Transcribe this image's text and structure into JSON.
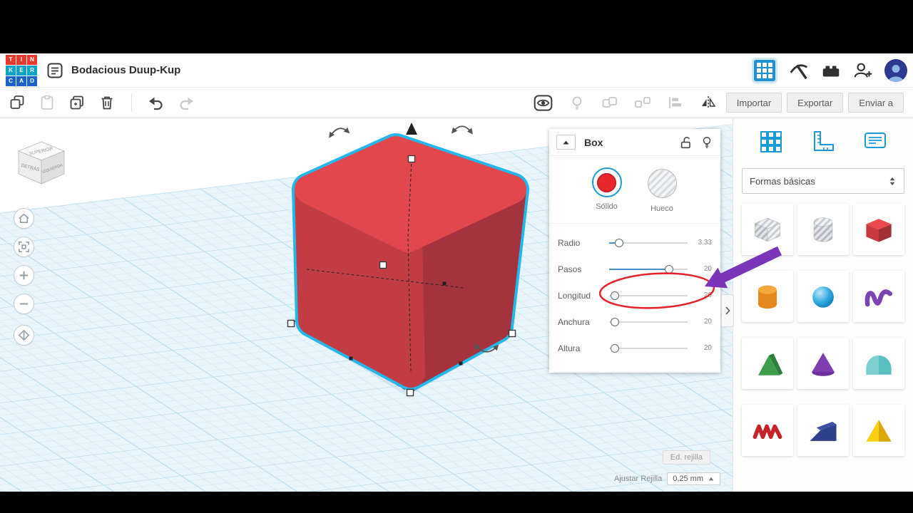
{
  "header": {
    "logo_rows": [
      [
        "T",
        "I",
        "N"
      ],
      [
        "K",
        "E",
        "R"
      ],
      [
        "C",
        "A",
        "D"
      ]
    ],
    "title": "Bodacious Duup-Kup"
  },
  "toolbar": {
    "import": "Importar",
    "export": "Exportar",
    "send": "Enviar a"
  },
  "viewport": {
    "viewcube": {
      "top": "SUPERIOR",
      "left": "DETRÁS",
      "right": "IZQUIERDA"
    },
    "grid_edit": "Ed. rejilla",
    "snap_label": "Ajustar Rejilla",
    "snap_value": "0,25 mm"
  },
  "inspector": {
    "title": "Box",
    "materials": [
      {
        "label": "Sólido",
        "selected": true
      },
      {
        "label": "Hueco",
        "selected": false
      }
    ],
    "sliders": [
      {
        "label": "Radio",
        "value": "3.33",
        "knob_pct": 13,
        "fill_pct": 9
      },
      {
        "label": "Pasos",
        "value": "20",
        "knob_pct": 76,
        "fill_pct": 76
      },
      {
        "label": "Longitud",
        "value": "20",
        "knob_pct": 7,
        "fill_pct": 0
      },
      {
        "label": "Anchura",
        "value": "20",
        "knob_pct": 7,
        "fill_pct": 0
      },
      {
        "label": "Altura",
        "value": "20",
        "knob_pct": 7,
        "fill_pct": 0
      }
    ]
  },
  "sidebar": {
    "category": "Formas básicas",
    "shapes": [
      "box-hole",
      "cylinder-hole",
      "box",
      "cylinder",
      "sphere",
      "scribble",
      "roof",
      "cone",
      "round-roof",
      "text",
      "wedge",
      "pyramid"
    ]
  },
  "colors": {
    "accent_blue": "#1c9ad6",
    "selection_cyan": "#25b6ea",
    "cube_top": "#e2474d",
    "cube_left": "#c23c44",
    "cube_right": "#a4333d",
    "slider_fill": "#4a90d2",
    "annotation_purple": "#7b35b8",
    "annotation_red": "#e8212a"
  }
}
